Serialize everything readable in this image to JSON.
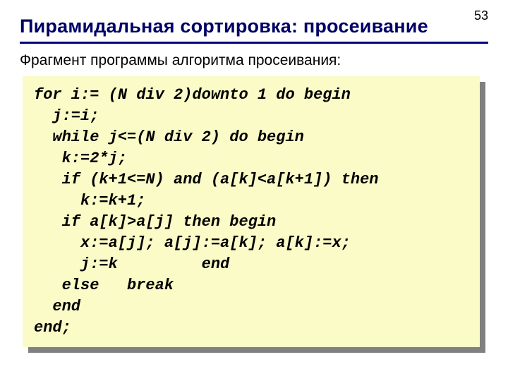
{
  "page_number": "53",
  "title": "Пирамидальная сортировка: просеивание",
  "subtitle": "Фрагмент программы алгоритма просеивания:",
  "code": {
    "l1": "for i:= (N div 2)downto 1 do begin",
    "l2": "  j:=i;",
    "l3": "  while j<=(N div 2) do begin",
    "l4": "   k:=2*j;",
    "l5": "   if (k+1<=N) and (a[k]<a[k+1]) then",
    "l6": "     k:=k+1;",
    "l7": "   if a[k]>a[j] then begin",
    "l8": "     x:=a[j]; a[j]:=a[k]; a[k]:=x;",
    "l9": "     j:=k         end",
    "l10": "   else   break",
    "l11": "  end",
    "l12": "end;"
  }
}
